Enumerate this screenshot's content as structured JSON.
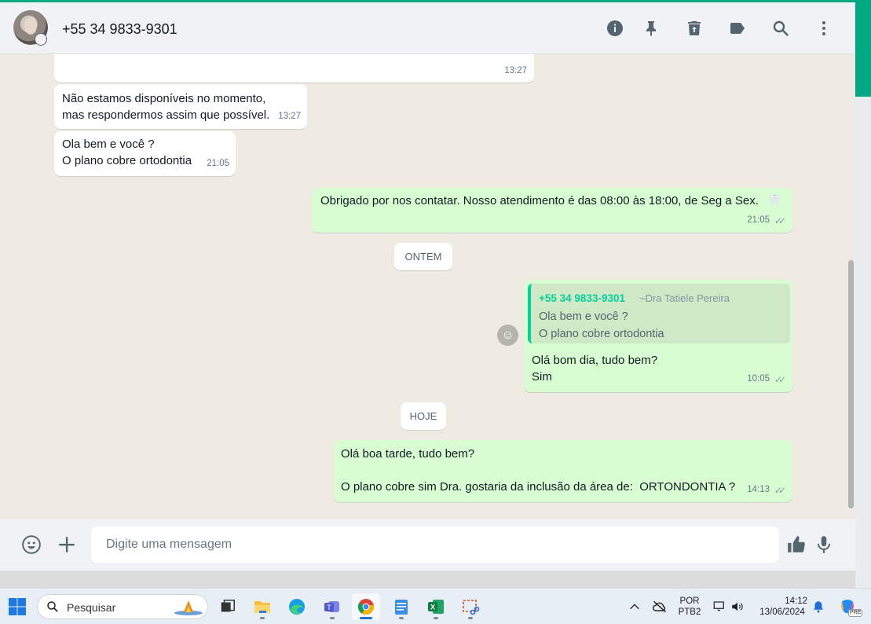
{
  "header": {
    "contact_name": "+55 34 9833-9301",
    "icons": [
      "info-icon",
      "pin-icon",
      "delete-icon",
      "label-icon",
      "search-icon",
      "menu-icon"
    ]
  },
  "messages": [
    {
      "direction": "in",
      "text": "",
      "time": "13:27"
    },
    {
      "direction": "in",
      "text": "Não estamos disponíveis no momento,\nmas respondermos assim que possível.",
      "time": "13:27"
    },
    {
      "direction": "in",
      "text": "Ola bem e você ?\nO plano cobre ortodontia",
      "time": "21:05"
    },
    {
      "direction": "out",
      "text": "Obrigado por nos contatar. Nosso atendimento é das 08:00 às 18:00, de Seg a Sex.",
      "emoji": "🦷",
      "time": "21:05"
    },
    {
      "direction": "out",
      "quote": {
        "author": "+55 34 9833-9301",
        "alias": "~Dra Tatiele Pereira",
        "line1": "Ola bem e você ?",
        "line2": "O plano cobre ortodontia"
      },
      "text": "Olá bom dia, tudo bem?\nSim",
      "time": "10:05"
    },
    {
      "direction": "out",
      "text": "Olá boa tarde, tudo bem?\n\nO plano cobre sim Dra. gostaria da inclusão da área de:  ORTONDONTIA ?",
      "time": "14:13"
    }
  ],
  "day_separators": {
    "yesterday": "ONTEM",
    "today": "HOJE"
  },
  "composer": {
    "placeholder": "Digite uma mensagem",
    "icons": [
      "emoji-icon",
      "plus-icon",
      "thumbs-up-icon",
      "microphone-icon"
    ]
  },
  "taskbar": {
    "search_label": "Pesquisar",
    "language_line1": "POR",
    "language_line2": "PTB2",
    "time": "14:12",
    "date": "13/06/2024",
    "copilot_badge": "PRE"
  },
  "colors": {
    "accent": "#00a884",
    "outgoing_bubble": "#d9fdd3",
    "incoming_bubble": "#ffffff",
    "chat_background": "#efeae2",
    "quote_author": "#06cf9c"
  }
}
